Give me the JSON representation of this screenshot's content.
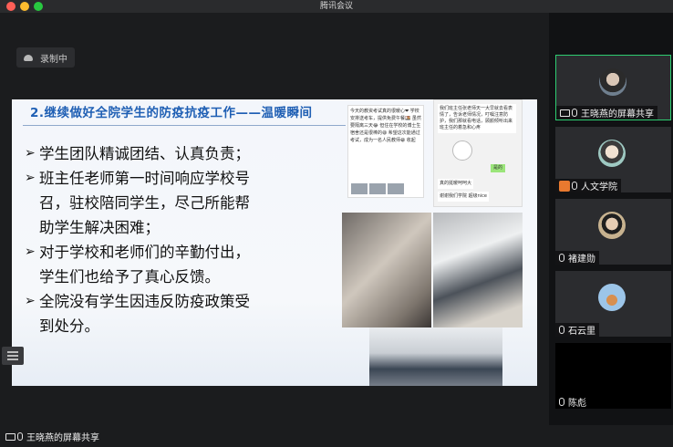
{
  "window": {
    "title": "腾讯会议"
  },
  "recording": {
    "label": "录制中"
  },
  "slide": {
    "title": "2.继续做好全院学生的防疫抗疫工作——温暖瞬间",
    "bullets": [
      {
        "lines": [
          "学生团队精诚团结、认真负责；"
        ]
      },
      {
        "lines": [
          "班主任老师第一时间响应学校号",
          "召，驻校陪同学生，尽己所能帮",
          "助学生解决困难；"
        ]
      },
      {
        "lines": [
          "对于学校和老师们的辛勤付出，",
          "学生们也给予了真心反馈。"
        ]
      },
      {
        "lines": [
          "全院没有学生因违反防疫政策受",
          "到处分。"
        ]
      }
    ],
    "chat1": "今天的教资考试真的很暖心❤ 学校安排送考车，提供免费午餐🍱 虽然要隔离三天😂 但住在学校的博士生宿舍还是很棒的😆 希望这次能通过考试，成为一名人民教师😁 收起",
    "chat2": {
      "msg1": "我们班主任张老师天一大早就去看表情了，告诉老师情况，叮嘱注意防护，我们那就看电话，顾颜倾听出来班主任的着急和心疼",
      "reply": "是的",
      "msg2": "真的挺暖呵呵大",
      "msg3": "谢谢我们学院 超级nice"
    }
  },
  "participants": [
    {
      "name": "王晓燕的屏幕共享",
      "active": true,
      "icons": [
        "screen-share",
        "mic"
      ]
    },
    {
      "name": "人文学院",
      "active": false,
      "icons": [
        "host",
        "mic"
      ]
    },
    {
      "name": "褚建勋",
      "active": false,
      "icons": [
        "mic"
      ]
    },
    {
      "name": "石云里",
      "active": false,
      "icons": [
        "mic"
      ]
    },
    {
      "name": "陈彪",
      "active": false,
      "icons": [
        "mic"
      ]
    }
  ],
  "share_status": {
    "label": "王晓燕的屏幕共享"
  },
  "colors": {
    "accent": "#2ecc71",
    "slide_title": "#1f5fb4",
    "host_badge": "#e8792f"
  }
}
